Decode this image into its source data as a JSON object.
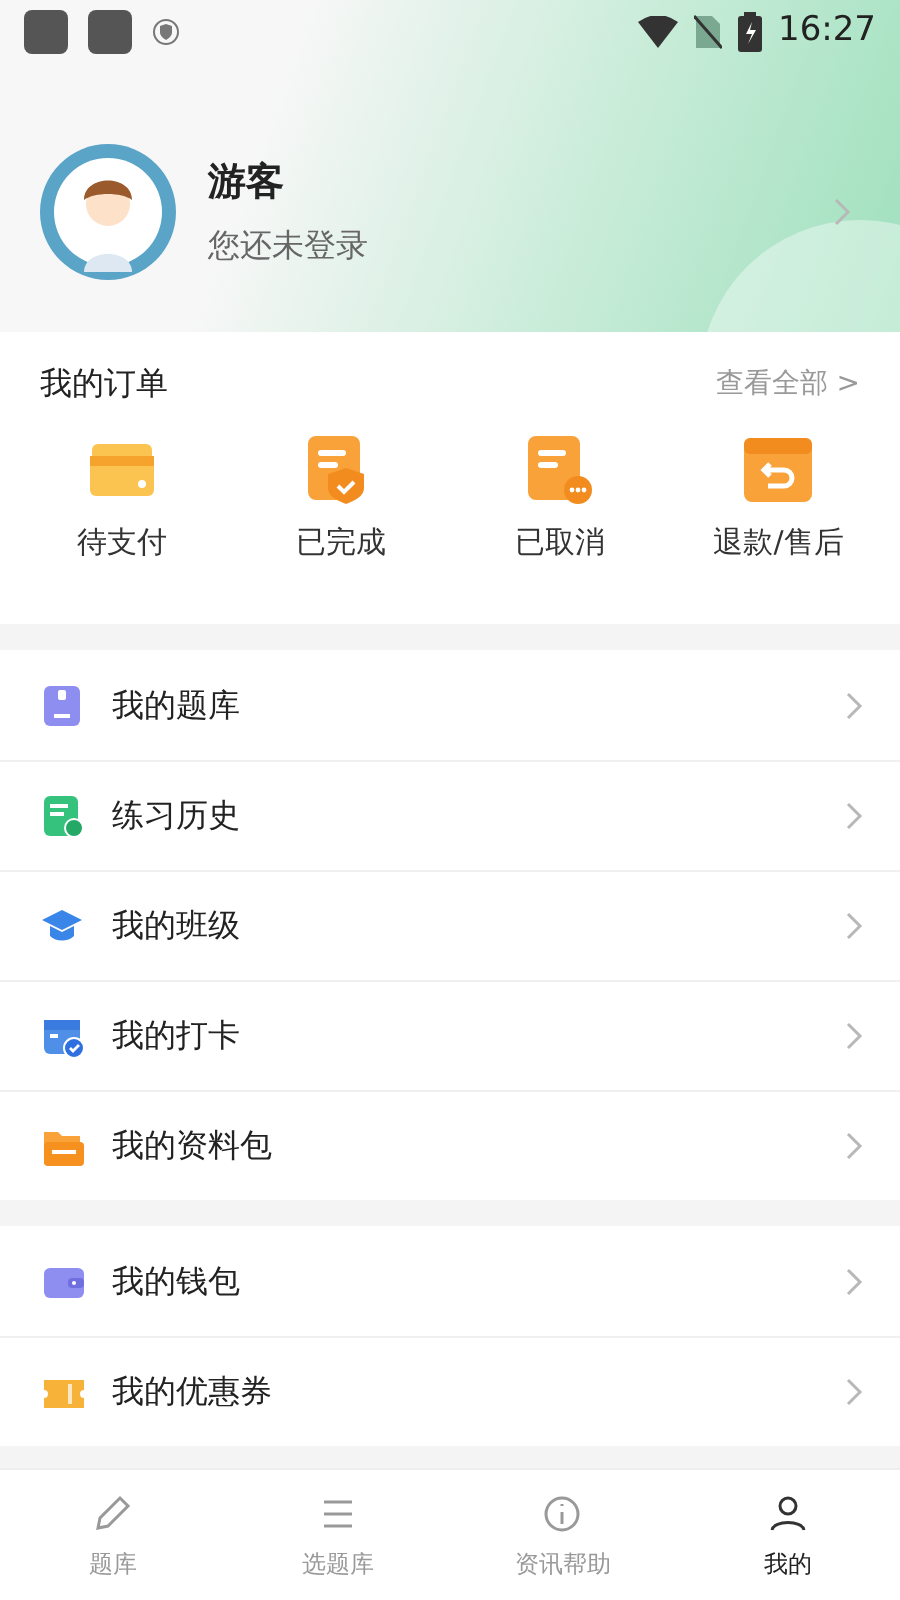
{
  "status_bar": {
    "time": "16:27"
  },
  "profile": {
    "name": "游客",
    "subtitle": "您还未登录"
  },
  "orders": {
    "title": "我的订单",
    "view_all": "查看全部 >",
    "items": [
      {
        "kind": "pay",
        "label": "待支付"
      },
      {
        "kind": "done",
        "label": "已完成"
      },
      {
        "kind": "cancel",
        "label": "已取消"
      },
      {
        "kind": "refund",
        "label": "退款/售后"
      }
    ]
  },
  "menu_groups": [
    [
      {
        "kind": "bank",
        "label": "我的题库"
      },
      {
        "kind": "history",
        "label": "练习历史"
      },
      {
        "kind": "class",
        "label": "我的班级"
      },
      {
        "kind": "checkin",
        "label": "我的打卡"
      },
      {
        "kind": "folder",
        "label": "我的资料包"
      }
    ],
    [
      {
        "kind": "wallet",
        "label": "我的钱包"
      },
      {
        "kind": "coupon",
        "label": "我的优惠券"
      }
    ]
  ],
  "bottom_nav": [
    {
      "kind": "pencil",
      "label": "题库",
      "selected": false
    },
    {
      "kind": "list",
      "label": "选题库",
      "selected": false
    },
    {
      "kind": "info",
      "label": "资讯帮助",
      "selected": false
    },
    {
      "kind": "user",
      "label": "我的",
      "selected": true
    }
  ]
}
